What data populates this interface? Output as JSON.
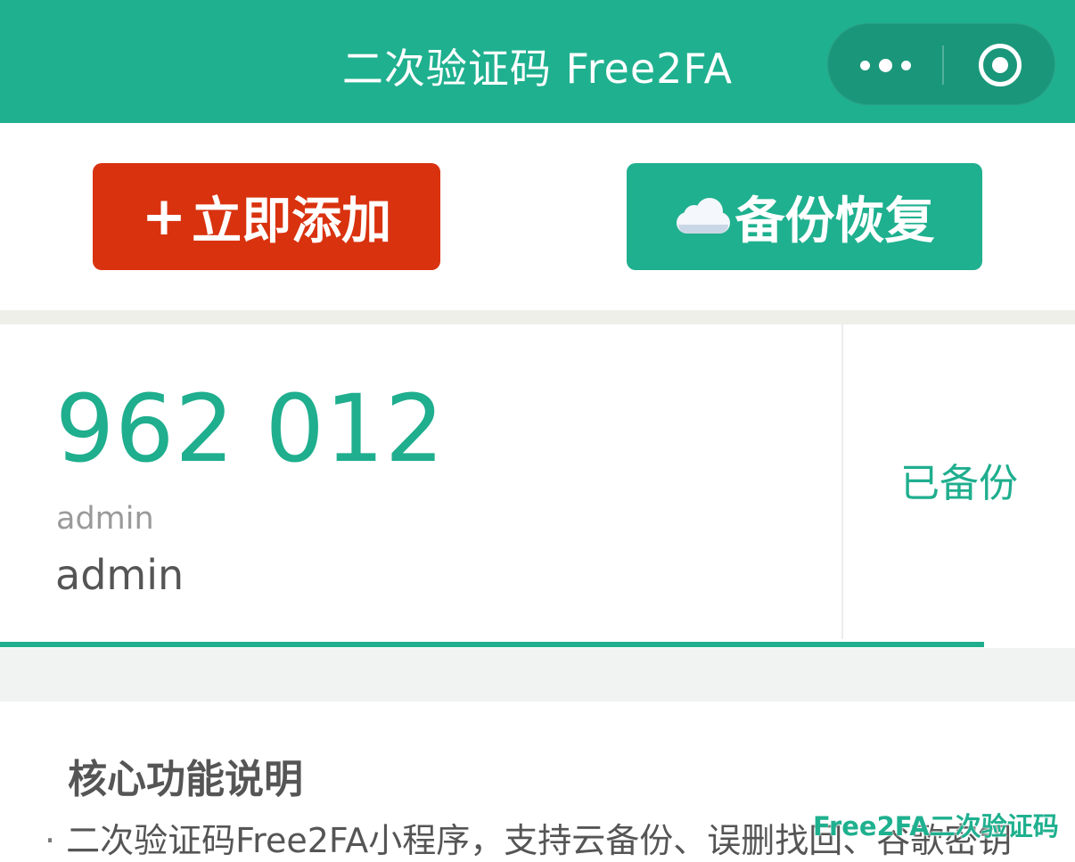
{
  "header": {
    "title": "二次验证码 Free2FA",
    "more_icon": "more-dots-icon",
    "close_icon": "target-circle-icon",
    "background_color": "#1fb08f"
  },
  "actions": {
    "add_plus": "+",
    "add_label": "立即添加",
    "add_color": "#d9320f",
    "backup_icon": "cloud-icon",
    "backup_label": "备份恢复",
    "backup_color": "#1fb08f"
  },
  "token": {
    "code": "962 012",
    "issuer": "admin",
    "account": "admin",
    "backup_status": "已备份",
    "accent_color": "#1fae8e",
    "time_progress": 1.0
  },
  "info": {
    "title": "核心功能说明",
    "bullet": "·",
    "line1": "二次验证码Free2FA小程序，支持云备份、误删找回、谷歌密钥"
  },
  "watermark": "Free2FA二次验证码"
}
